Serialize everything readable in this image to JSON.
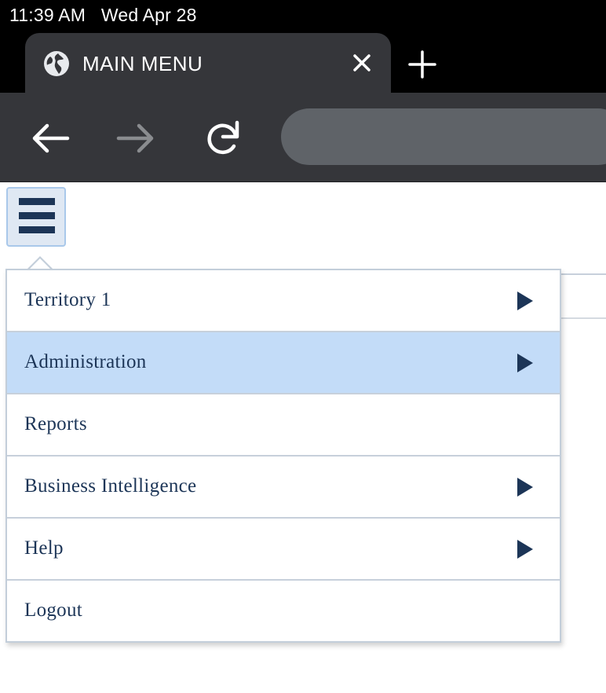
{
  "status_bar": {
    "text": "11:39 AM   Wed Apr 28"
  },
  "browser": {
    "tab": {
      "title": "MAIN MENU",
      "favicon": "globe-icon",
      "close_icon": "close-icon"
    },
    "new_tab_icon": "plus-icon",
    "toolbar": {
      "back_icon": "back-arrow-icon",
      "forward_icon": "forward-arrow-icon",
      "reload_icon": "reload-icon",
      "address": ""
    },
    "colors": {
      "chrome_dark": "#35363a",
      "omnibox": "#5f6368"
    }
  },
  "page": {
    "menu_toggle_icon": "hamburger-menu-icon",
    "menu": {
      "items": [
        {
          "label": "Territory 1",
          "has_submenu": true,
          "highlighted": false
        },
        {
          "label": "Administration",
          "has_submenu": true,
          "highlighted": true
        },
        {
          "label": "Reports",
          "has_submenu": false,
          "highlighted": false
        },
        {
          "label": "Business Intelligence",
          "has_submenu": true,
          "highlighted": false
        },
        {
          "label": "Help",
          "has_submenu": true,
          "highlighted": false
        },
        {
          "label": "Logout",
          "has_submenu": false,
          "highlighted": false
        }
      ]
    },
    "colors": {
      "menu_text": "#1c3557",
      "highlight": "#c3dcf8",
      "border": "#c7d0db"
    }
  }
}
